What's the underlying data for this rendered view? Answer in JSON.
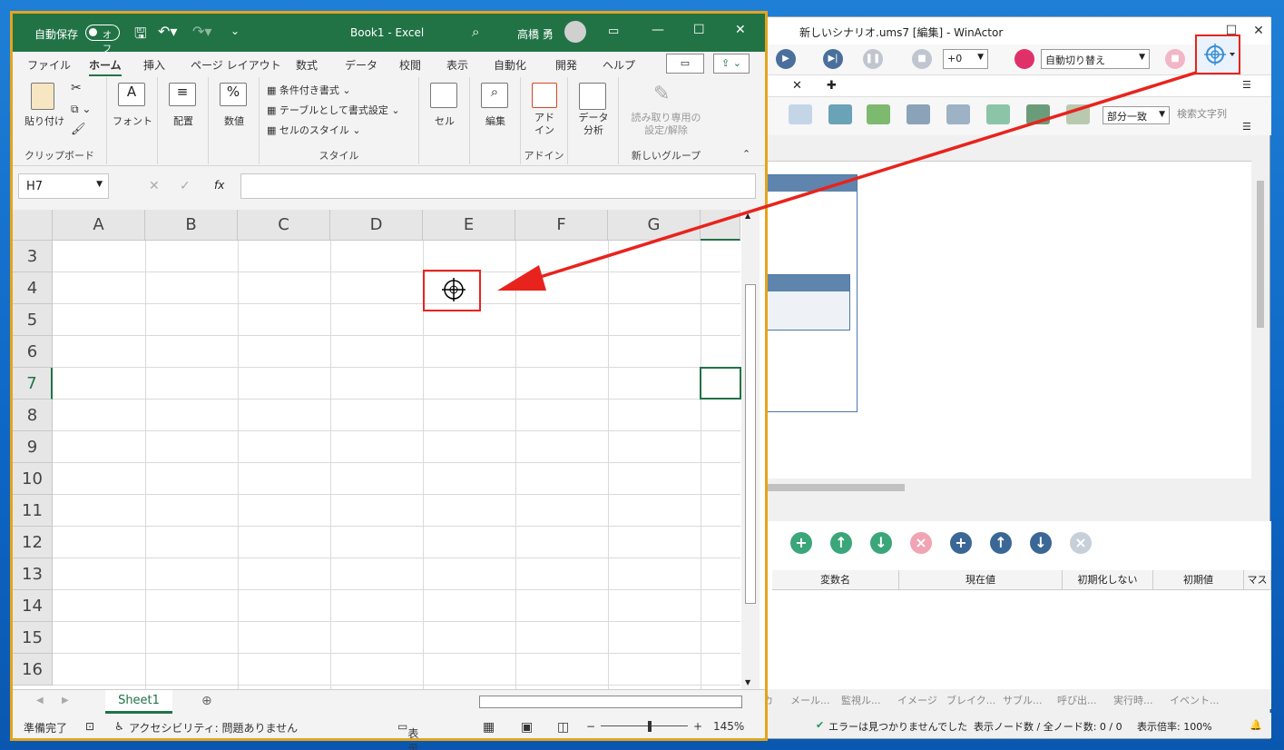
{
  "winactor": {
    "title": "新しいシナリオ.ums7 [編集] - WinActor",
    "speed": "+0",
    "mode_select": "自動切り替え",
    "search_mode": "部分一致",
    "search_placeholder": "検索文字列",
    "tab_close": "✕",
    "tab_add": "✚",
    "var_columns": [
      "変数名",
      "現在値",
      "初期化しない",
      "初期値",
      "マス"
    ],
    "bottom_tabs": [
      "カ",
      "メール...",
      "監視ル...",
      "イメージ",
      "ブレイク...",
      "サブル...",
      "呼び出...",
      "実行時...",
      "イベント..."
    ],
    "status_error": "エラーは見つかりませんでした",
    "status_nodes": "表示ノード数 / 全ノード数: 0 / 0",
    "status_zoom": "表示倍率: 100%"
  },
  "excel": {
    "autosave_label": "自動保存",
    "autosave_state": "オフ",
    "title": "Book1  -  Excel",
    "user": "高橋 勇",
    "menu": [
      "ファイル",
      "ホーム",
      "挿入",
      "ページ レイアウト",
      "数式",
      "データ",
      "校閲",
      "表示",
      "自動化",
      "開発",
      "ヘルプ"
    ],
    "ribbon": {
      "paste": "貼り付け",
      "clipboard": "クリップボード",
      "font": "フォント",
      "align": "配置",
      "number": "数値",
      "percent": "%",
      "cond_format": "条件付き書式",
      "table_format": "テーブルとして書式設定",
      "cell_style": "セルのスタイル",
      "style_group": "スタイル",
      "cells": "セル",
      "edit": "編集",
      "addin": "アド\nイン",
      "addin_group": "アドイン",
      "data_analysis": "データ\n分析",
      "readonly": "読み取り専用の\n設定/解除",
      "new_group": "新しいグループ"
    },
    "name_box": "H7",
    "fx": "fx",
    "columns": [
      "A",
      "B",
      "C",
      "D",
      "E",
      "F",
      "G"
    ],
    "rows": [
      "3",
      "4",
      "5",
      "6",
      "7",
      "8",
      "9",
      "10",
      "11",
      "12",
      "13",
      "14",
      "15",
      "16"
    ],
    "sheet_tab": "Sheet1",
    "status_ready": "準備完了",
    "status_access": "アクセシビリティ: 問題ありません",
    "status_display": "表示設定",
    "zoom": "145%"
  },
  "colors": {
    "excel_green": "#217346",
    "highlight_red": "#e8231d",
    "border_orange": "#e5a41c"
  }
}
